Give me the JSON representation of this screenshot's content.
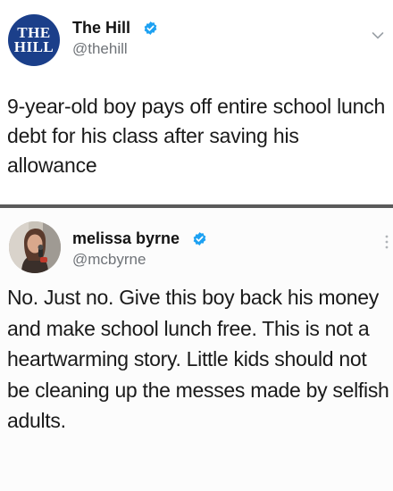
{
  "tweet1": {
    "logo_text": [
      "THE",
      "HILL"
    ],
    "name": "The Hill",
    "handle": "@thehill",
    "verified_icon": "verified-badge-icon",
    "menu_icon": "chevron-down-icon",
    "text": "9-year-old boy pays off entire school lunch debt for his class after saving his allowance"
  },
  "tweet2": {
    "name": "melissa byrne",
    "handle": "@mcbyrne",
    "verified_icon": "verified-badge-icon",
    "menu_icon": "more-vertical-icon",
    "text": "No. Just no. Give this boy back his money and make school lunch free. This is not a heartwarming story. Little kids should not be cleaning up the messes made by selfish adults."
  },
  "colors": {
    "verified": "#1da1f2",
    "logo_bg": "#1b3f8a",
    "handle": "#6f7378",
    "divider": "#5a5a5a"
  }
}
